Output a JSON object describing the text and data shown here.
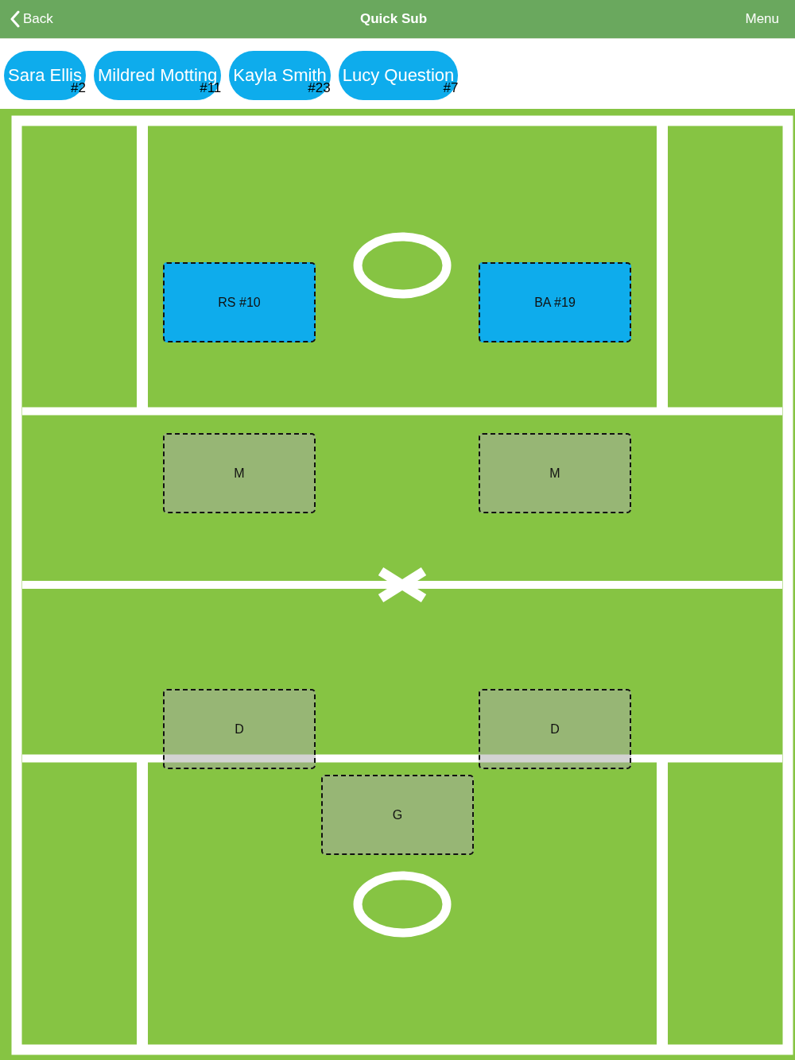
{
  "nav": {
    "back": "Back",
    "title": "Quick Sub",
    "menu": "Menu"
  },
  "bench": [
    {
      "name": "Sara Ellis",
      "number": "#2"
    },
    {
      "name": "Mildred Motting",
      "number": "#11"
    },
    {
      "name": "Kayla Smith",
      "number": "#23"
    },
    {
      "name": "Lucy Question",
      "number": "#7"
    }
  ],
  "positions": [
    {
      "label": "RS #10",
      "occupied": true
    },
    {
      "label": "BA #19",
      "occupied": true
    },
    {
      "label": "M",
      "occupied": false
    },
    {
      "label": "M",
      "occupied": false
    },
    {
      "label": "D",
      "occupied": false
    },
    {
      "label": "D",
      "occupied": false
    },
    {
      "label": "G",
      "occupied": false
    }
  ]
}
